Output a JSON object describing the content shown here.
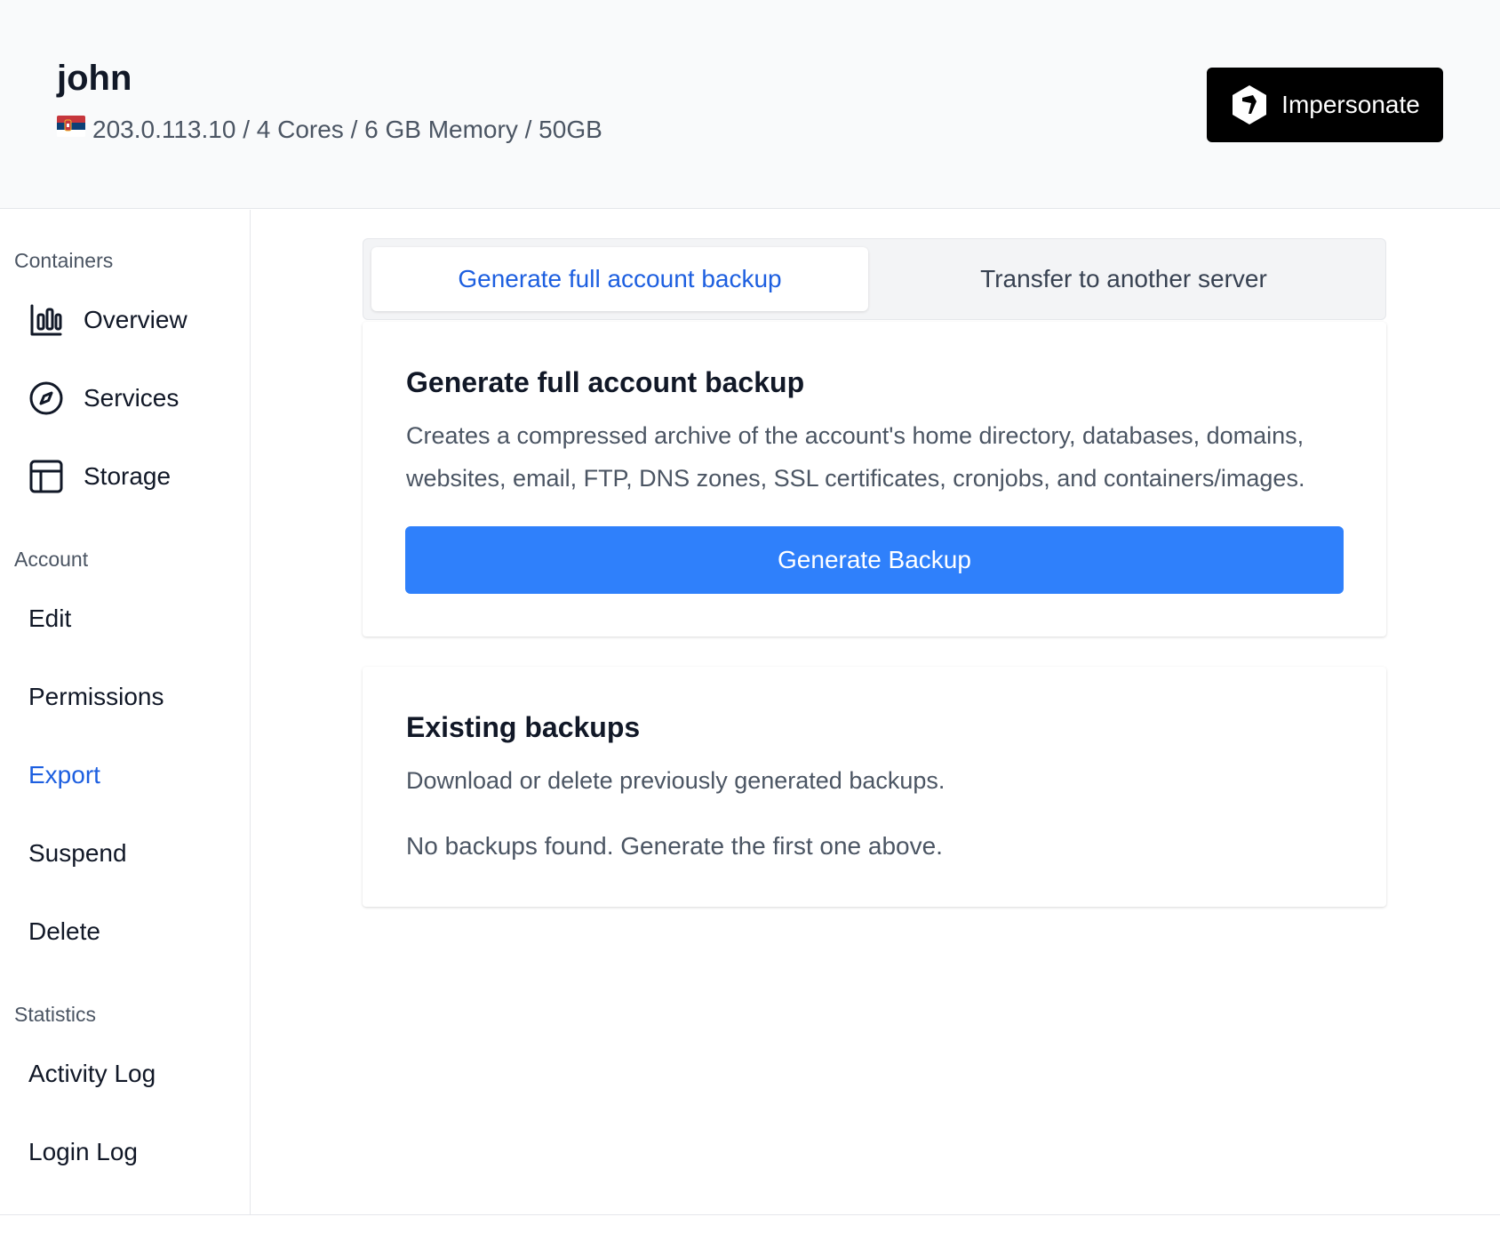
{
  "header": {
    "username": "john",
    "server_info": "203.0.113.10 / 4 Cores / 6 GB Memory / 50GB",
    "flag_icon": "serbia-flag-icon",
    "impersonate_label": "Impersonate"
  },
  "sidebar": {
    "sections": {
      "containers": "Containers",
      "account": "Account",
      "statistics": "Statistics"
    },
    "items": {
      "overview": "Overview",
      "services": "Services",
      "storage": "Storage",
      "edit": "Edit",
      "permissions": "Permissions",
      "export": "Export",
      "suspend": "Suspend",
      "delete": "Delete",
      "activity_log": "Activity Log",
      "login_log": "Login Log"
    },
    "active_item": "Export"
  },
  "tabs": {
    "backup": "Generate full account backup",
    "transfer": "Transfer to another server"
  },
  "backup_card": {
    "title": "Generate full account backup",
    "description": "Creates a compressed archive of the account's home directory, databases, domains, websites, email, FTP, DNS zones, SSL certificates, cronjobs, and containers/images.",
    "button_label": "Generate Backup"
  },
  "existing_card": {
    "title": "Existing backups",
    "description": "Download or delete previously generated backups.",
    "empty_message": "No backups found. Generate the first one above."
  },
  "colors": {
    "accent": "#1d5fe0",
    "primary_button": "#2f80fb",
    "impersonate_button": "#000000"
  }
}
